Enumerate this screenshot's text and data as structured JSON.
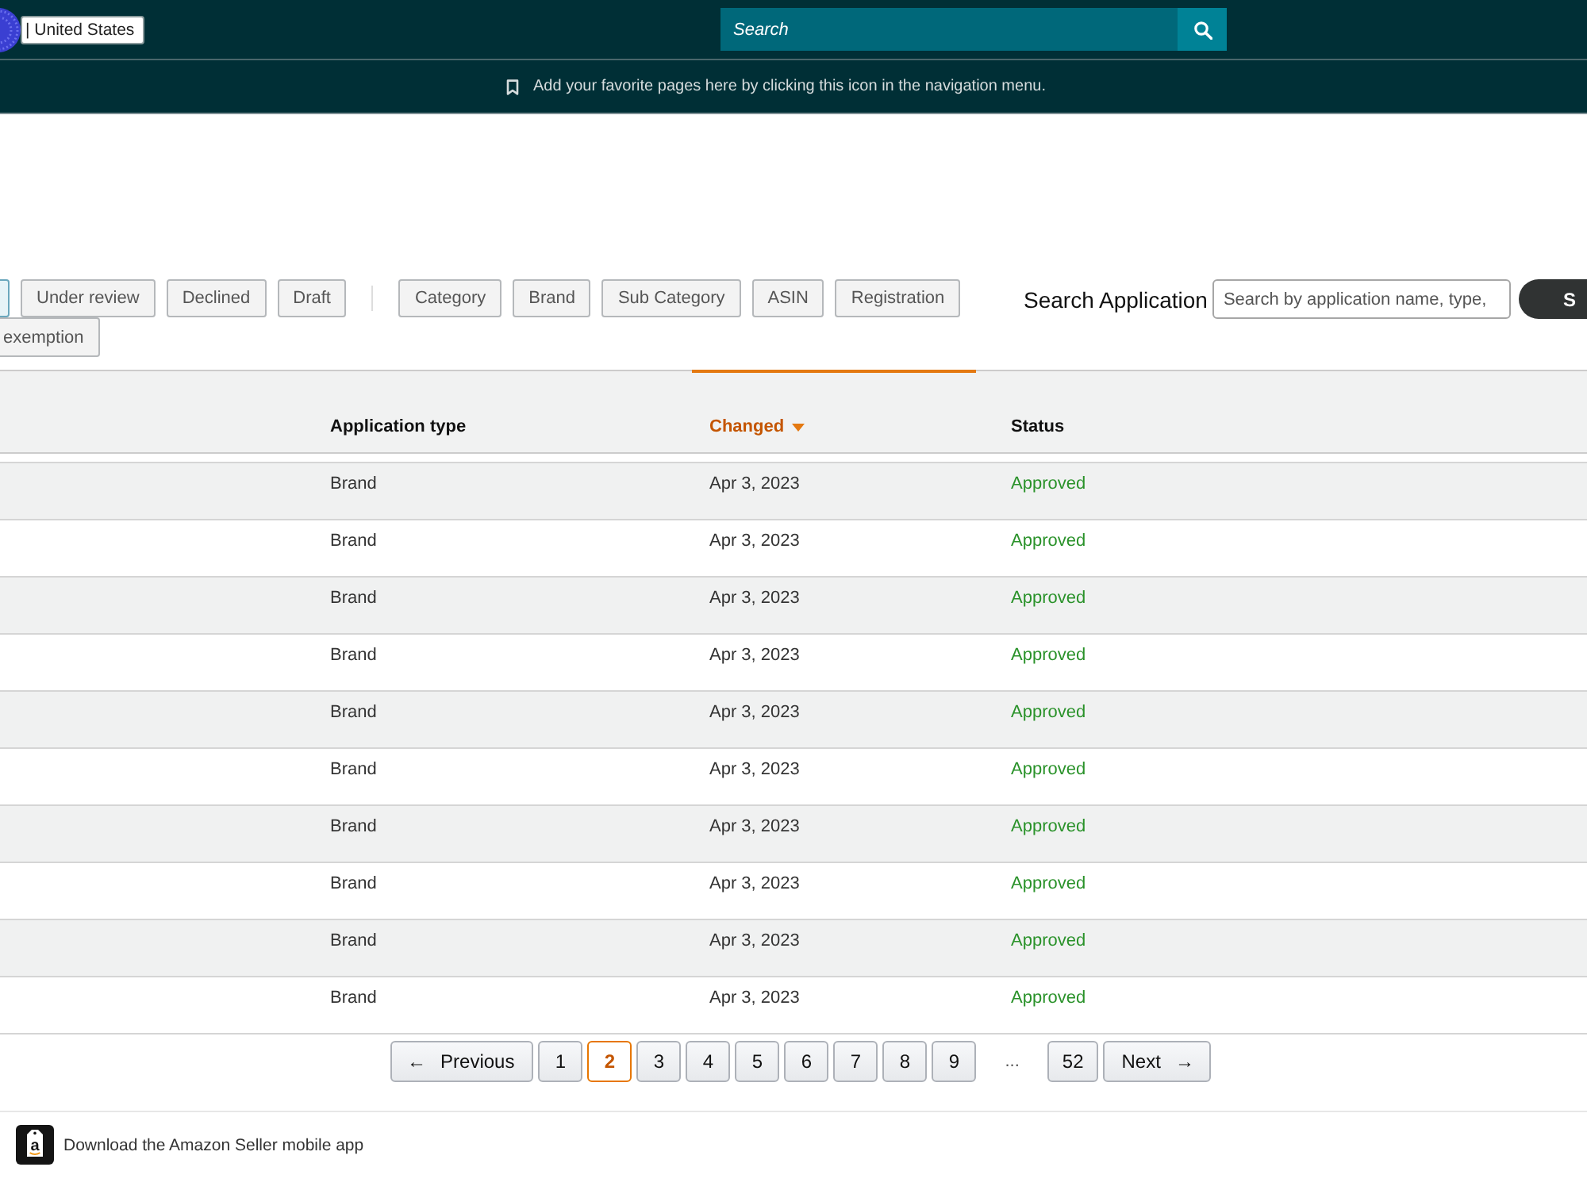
{
  "top_bar": {
    "marketplace": "| United States",
    "search": {
      "placeholder": "Search"
    }
  },
  "favorites_bar": {
    "message": "Add your favorite pages here by clicking this icon in the navigation menu."
  },
  "status_filters": [
    {
      "selected": true
    },
    {
      "label": "Under review",
      "selected": false
    },
    {
      "label": "Declined",
      "selected": false
    },
    {
      "label": "Draft",
      "selected": false
    }
  ],
  "type_filters": [
    {
      "label": "Category",
      "selected": false
    },
    {
      "label": "Brand",
      "selected": false
    },
    {
      "label": "Sub Category",
      "selected": false
    },
    {
      "label": "ASIN",
      "selected": false
    },
    {
      "label": "Registration",
      "selected": false
    },
    {
      "label": "exemption",
      "selected": false
    }
  ],
  "search_application": {
    "label": "Search Application",
    "placeholder": "Search by application name, type,",
    "button": "S"
  },
  "table": {
    "columns": [
      {
        "label": "Application type",
        "sorted": false
      },
      {
        "label": "Changed",
        "sorted": true
      },
      {
        "label": "Status",
        "sorted": false
      }
    ],
    "rows": [
      {
        "application_type": "Brand",
        "changed": "Apr 3, 2023",
        "status": "Approved"
      },
      {
        "application_type": "Brand",
        "changed": "Apr 3, 2023",
        "status": "Approved"
      },
      {
        "application_type": "Brand",
        "changed": "Apr 3, 2023",
        "status": "Approved"
      },
      {
        "application_type": "Brand",
        "changed": "Apr 3, 2023",
        "status": "Approved"
      },
      {
        "application_type": "Brand",
        "changed": "Apr 3, 2023",
        "status": "Approved"
      },
      {
        "application_type": "Brand",
        "changed": "Apr 3, 2023",
        "status": "Approved"
      },
      {
        "application_type": "Brand",
        "changed": "Apr 3, 2023",
        "status": "Approved"
      },
      {
        "application_type": "Brand",
        "changed": "Apr 3, 2023",
        "status": "Approved"
      },
      {
        "application_type": "Brand",
        "changed": "Apr 3, 2023",
        "status": "Approved"
      },
      {
        "application_type": "Brand",
        "changed": "Apr 3, 2023",
        "status": "Approved"
      }
    ]
  },
  "pagination": {
    "previous": {
      "arrow": "←",
      "label": "Previous"
    },
    "pages": [
      {
        "kind": "page",
        "label": "1",
        "selected": false
      },
      {
        "kind": "page",
        "label": "2",
        "selected": true
      },
      {
        "kind": "page",
        "label": "3",
        "selected": false
      },
      {
        "kind": "page",
        "label": "4",
        "selected": false
      },
      {
        "kind": "page",
        "label": "5",
        "selected": false
      },
      {
        "kind": "page",
        "label": "6",
        "selected": false
      },
      {
        "kind": "page",
        "label": "7",
        "selected": false
      },
      {
        "kind": "page",
        "label": "8",
        "selected": false
      },
      {
        "kind": "page",
        "label": "9",
        "selected": false
      },
      {
        "kind": "ellipsis",
        "label": "..."
      },
      {
        "kind": "page",
        "label": "52",
        "selected": false
      }
    ],
    "next": {
      "arrow": "→",
      "label": "Next"
    }
  },
  "footer": {
    "app_icon_letter": "a",
    "text": "Download the Amazon Seller mobile app"
  }
}
